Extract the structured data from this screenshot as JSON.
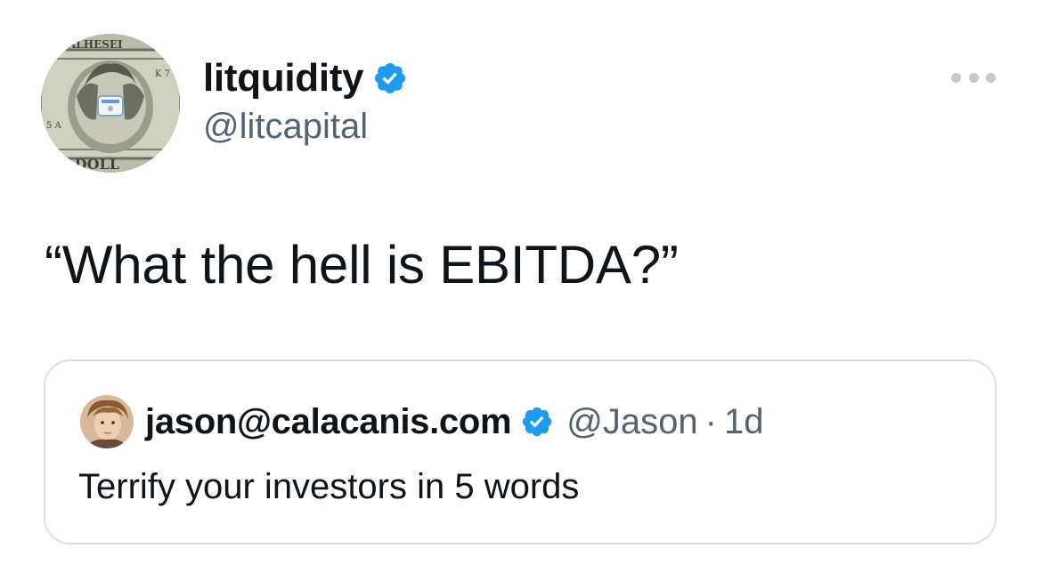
{
  "tweet": {
    "author": {
      "display_name": "litquidity",
      "handle": "@litcapital",
      "verified_icon": "verified-badge-icon",
      "avatar_icon": "dollar-bill-avatar"
    },
    "more_icon": "more-horizontal-icon",
    "text": "“What the hell is EBITDA?”"
  },
  "quoted_tweet": {
    "author": {
      "display_name": "jason@calacanis.com",
      "handle": "@Jason",
      "verified_icon": "verified-badge-icon",
      "avatar_icon": "user-photo-avatar"
    },
    "separator": "·",
    "timestamp": "1d",
    "text": "Terrify your investors in 5 words"
  },
  "colors": {
    "text_primary": "#0f1419",
    "text_secondary": "#536471",
    "verified_blue": "#1d9bf0",
    "border": "#dcdfe2"
  }
}
